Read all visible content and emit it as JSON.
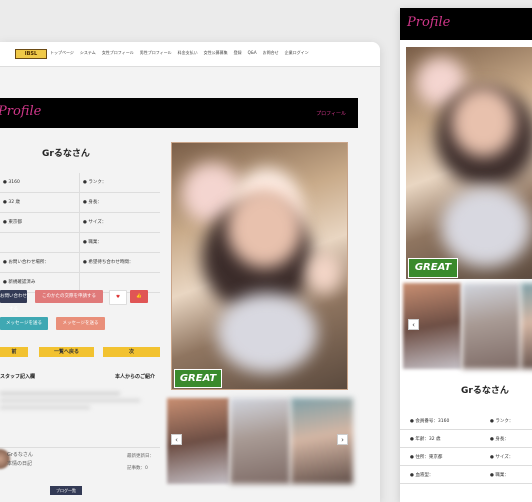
{
  "nav": {
    "logo": "IBSL",
    "items": [
      "トップページ",
      "システム",
      "女性プロフィール",
      "男性プロフィール",
      "料金支払い",
      "女性公募募集",
      "登録",
      "Q&A",
      "お問合せ",
      "企業ログイン"
    ]
  },
  "banner": {
    "script_title": "Profile",
    "label": "プロフィール"
  },
  "profile": {
    "name": "Grるなさん",
    "rows": [
      [
        "● 3160",
        "● ランク："
      ],
      [
        "● 32 歳",
        "● 身長："
      ],
      [
        "● 東京都",
        "● サイズ："
      ],
      [
        "",
        "● 職業："
      ],
      [
        "● お問い合わせ場所：",
        "● 希望待ち合わせ時間："
      ],
      [
        "● 新規確認済み",
        ""
      ]
    ]
  },
  "buttons": {
    "contact": "お問い合わせする",
    "favorite": "このかたの交際を申請する",
    "heart": "♥",
    "like": "👍",
    "send": "メッセージを送る",
    "report": "メッセージを送る"
  },
  "nav_buttons": {
    "prev": "前",
    "list": "一覧へ戻る",
    "next": "次"
  },
  "sections": {
    "staff_comment": "スタッフ記入欄",
    "self_intro": "本人からのご紹介"
  },
  "diary": {
    "name": "Grるなさん",
    "title": "本情の日記",
    "updated": "最新更新日：",
    "count": "記事数：0",
    "more_button": "ブログ一覧"
  },
  "photo_badge": "GREAT",
  "arrows": {
    "left": "‹",
    "right": "›"
  },
  "mobile": {
    "script_title": "Profile",
    "name": "Grるなさん",
    "rows": [
      [
        "● 会員番号：3160",
        "● ランク："
      ],
      [
        "● 年齢：32 歳",
        "● 身長："
      ],
      [
        "● 住所：東京都",
        "● サイズ："
      ],
      [
        "● 血液型：",
        "● 職業："
      ]
    ]
  }
}
